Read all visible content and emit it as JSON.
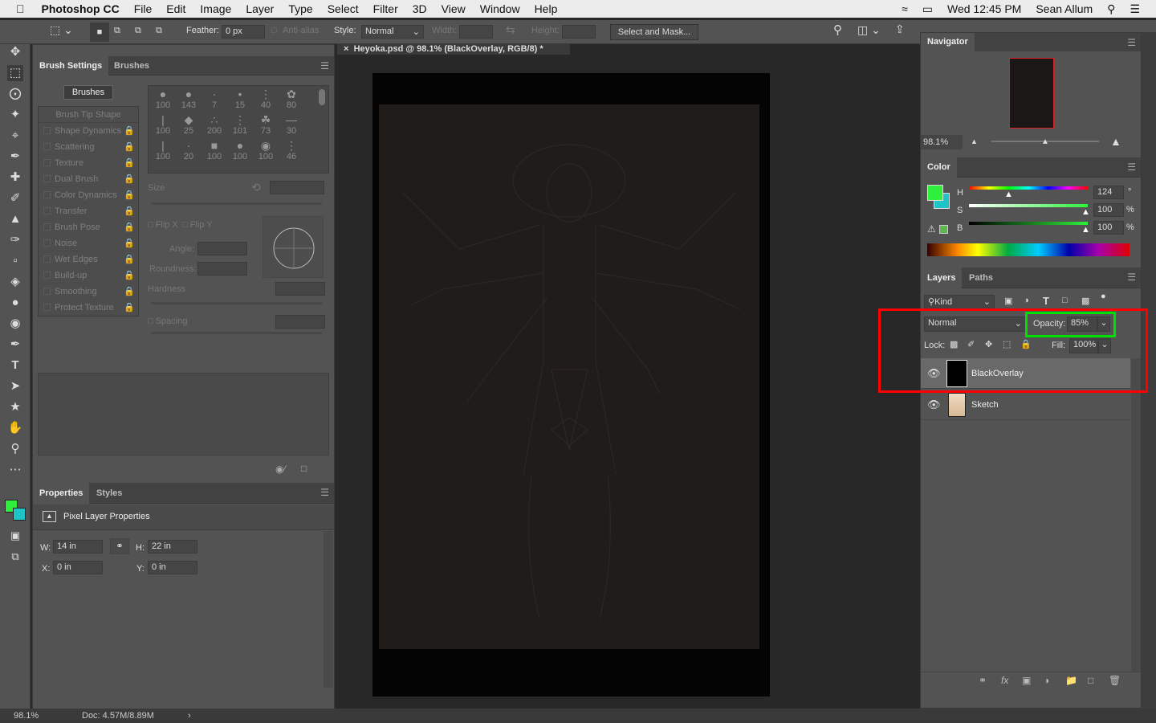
{
  "menubar": {
    "app": "Photoshop CC",
    "items": [
      "File",
      "Edit",
      "Image",
      "Layer",
      "Type",
      "Select",
      "Filter",
      "3D",
      "View",
      "Window",
      "Help"
    ],
    "clock": "Wed 12:45 PM",
    "user": "Sean Allum"
  },
  "options": {
    "feather_label": "Feather:",
    "feather_value": "0 px",
    "antialias_label": "Anti-alias",
    "style_label": "Style:",
    "style_value": "Normal",
    "width_label": "Width:",
    "height_label": "Height:",
    "select_mask": "Select and Mask..."
  },
  "brush_panel": {
    "tabs": [
      "Brush Settings",
      "Brushes"
    ],
    "brushes_button": "Brushes",
    "tip_shape": "Brush Tip Shape",
    "items": [
      "Shape Dynamics",
      "Scattering",
      "Texture",
      "Dual Brush",
      "Color Dynamics",
      "Transfer",
      "Brush Pose",
      "Noise",
      "Wet Edges",
      "Build-up",
      "Smoothing",
      "Protect Texture"
    ],
    "tip_sizes": [
      "100",
      "143",
      "7",
      "15",
      "40",
      "80",
      "100",
      "25",
      "200",
      "101",
      "73",
      "30",
      "100",
      "20",
      "100",
      "100",
      "100",
      "46"
    ],
    "size_label": "Size",
    "flip_x": "Flip X",
    "flip_y": "Flip Y",
    "angle_label": "Angle:",
    "roundness_label": "Roundness:",
    "hardness_label": "Hardness",
    "spacing_label": "Spacing"
  },
  "properties": {
    "tabs": [
      "Properties",
      "Styles"
    ],
    "title": "Pixel Layer Properties",
    "w_label": "W:",
    "w_value": "14 in",
    "h_label": "H:",
    "h_value": "22 in",
    "x_label": "X:",
    "x_value": "0 in",
    "y_label": "Y:",
    "y_value": "0 in"
  },
  "document": {
    "tab_title": "Heyoka.psd @ 98.1% (BlackOverlay, RGB/8) *"
  },
  "navigator": {
    "title": "Navigator",
    "zoom": "98.1%"
  },
  "color": {
    "title": "Color",
    "h_label": "H",
    "h_value": "124",
    "h_unit": "°",
    "s_label": "S",
    "s_value": "100",
    "s_unit": "%",
    "b_label": "B",
    "b_value": "100",
    "b_unit": "%",
    "foreground": "#2ef03a",
    "background": "#1fc4c8"
  },
  "layers": {
    "tabs": [
      "Layers",
      "Paths"
    ],
    "filter": "Kind",
    "blend_mode": "Normal",
    "opacity_label": "Opacity:",
    "opacity_value": "85%",
    "lock_label": "Lock:",
    "fill_label": "Fill:",
    "fill_value": "100%",
    "items": [
      {
        "name": "BlackOverlay",
        "visible": true,
        "selected": true
      },
      {
        "name": "Sketch",
        "visible": true,
        "selected": false
      }
    ]
  },
  "annotations": {
    "red_box": "#ff0000",
    "green_box": "#00e000"
  },
  "status": {
    "zoom": "98.1%",
    "doc": "Doc: 4.57M/8.89M"
  }
}
